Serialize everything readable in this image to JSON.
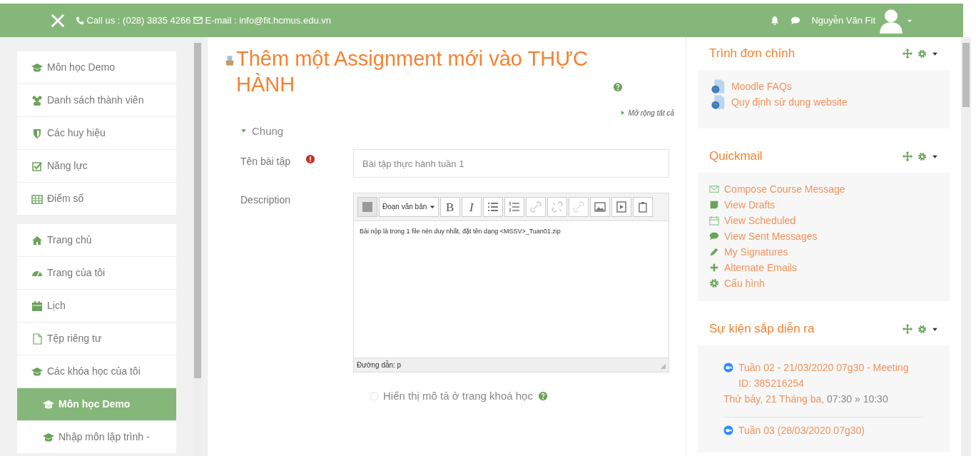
{
  "header": {
    "phone": "Call us : (028) 3835 4266",
    "email": "E-mail : info@fit.hcmus.edu.vn",
    "user": "Nguyễn Văn Fit"
  },
  "sidebar": {
    "groups": [
      [
        {
          "label": "Môn học Demo",
          "selected": false
        },
        {
          "label": "Danh sách thành viên",
          "selected": false
        },
        {
          "label": "Các huy hiệu",
          "selected": false
        },
        {
          "label": "Năng lực",
          "selected": false
        },
        {
          "label": "Điểm số",
          "selected": false
        }
      ],
      [
        {
          "label": "Trang chủ",
          "selected": false
        },
        {
          "label": "Trang của tôi",
          "selected": false
        },
        {
          "label": "Lịch",
          "selected": false
        },
        {
          "label": "Tệp riêng tư",
          "selected": false
        },
        {
          "label": "Các khóa học của tôi",
          "selected": false,
          "children": [
            {
              "label": "Môn học Demo",
              "selected": true
            },
            {
              "label": "Nhập môn lập trình -",
              "selected": false
            }
          ]
        }
      ]
    ]
  },
  "page": {
    "title": "Thêm một Assignment mới vào THỰC HÀNH",
    "expand_all": "Mở rộng tất cả",
    "section": {
      "label": "Chung",
      "expanded": true
    },
    "name_field": {
      "label": "Tên bài tập",
      "value": "Bài tập thực hành tuần 1"
    },
    "description": {
      "label": "Description",
      "format": "Đoạn văn bản",
      "bold": "B",
      "italic": "I",
      "text": "Bài nộp là trong 1 file nén duy nhất, đặt tên dạng <MSSV>_Tuan01.zip",
      "path": "Đường dẫn: p"
    },
    "show_description": {
      "label": "Hiển thị mô tả ở trang khoá học",
      "checked": false
    }
  },
  "blocks": [
    {
      "title": "Trình đơn chính",
      "kind": "links",
      "items": [
        "Moodle FAQs",
        "Quy định sử dụng website"
      ]
    },
    {
      "title": "Quickmail",
      "kind": "links",
      "items": [
        "Compose Course Message",
        "View Drafts",
        "View Scheduled",
        "View Sent Messages",
        "My Signatures",
        "Alternate Emails",
        "Cấu hình"
      ]
    },
    {
      "title": "Sự kiện sắp diễn ra",
      "kind": "events",
      "events": [
        {
          "title": "Tuần 02 - 21/03/2020 07g30 - Meeting ID: 385216254",
          "date": "Thứ bảy, 21 Tháng ba,",
          "time": "07:30 » 10:30"
        },
        {
          "title": "Tuần 03 (28/03/2020 07g30)"
        }
      ]
    }
  ]
}
